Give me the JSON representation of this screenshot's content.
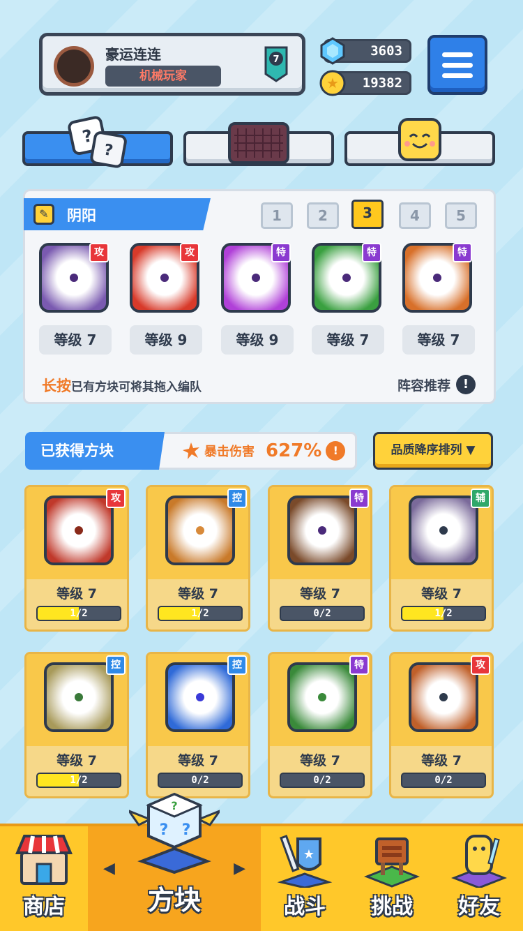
{
  "player": {
    "name": "豪运连连",
    "title": "机械玩家",
    "rank": "7"
  },
  "currency": {
    "gems": "3603",
    "coins": "19382"
  },
  "tabs": [
    {
      "name": "dice",
      "active": true
    },
    {
      "name": "board",
      "active": false
    },
    {
      "name": "emote",
      "active": false
    }
  ],
  "deck": {
    "name": "阴阳",
    "pages": [
      "1",
      "2",
      "3",
      "4",
      "5"
    ],
    "active_page": "3",
    "slots": [
      {
        "tag": "攻",
        "tag_type": "atk",
        "level": "等级 7",
        "color": "#7a5ab0"
      },
      {
        "tag": "攻",
        "tag_type": "atk",
        "level": "等级 9",
        "color": "#d83a2a"
      },
      {
        "tag": "特",
        "tag_type": "spc",
        "level": "等级 9",
        "color": "#b040d8"
      },
      {
        "tag": "特",
        "tag_type": "spc",
        "level": "等级 7",
        "color": "#3aa040"
      },
      {
        "tag": "特",
        "tag_type": "spc",
        "level": "等级 7",
        "color": "#d8702a"
      }
    ],
    "hint_highlight": "长按",
    "hint_text": "已有方块可将其拖入编队",
    "recommend": "阵容推荐"
  },
  "obtained": {
    "label": "已获得方块",
    "crit_label": "暴击伤害",
    "crit_value": "627%",
    "sort_label": "品质降序排列 ▼"
  },
  "blocks": [
    {
      "tag": "攻",
      "tag_type": "atk",
      "level": "等级 7",
      "progress": "1/2",
      "fill": 0.5,
      "color": "#c0392b",
      "core": "#8a2a1a"
    },
    {
      "tag": "控",
      "tag_type": "ctl",
      "level": "等级 7",
      "progress": "1/2",
      "fill": 0.5,
      "color": "#c97a2a",
      "core": "#d88a3a"
    },
    {
      "tag": "特",
      "tag_type": "spc",
      "level": "等级 7",
      "progress": "0/2",
      "fill": 0,
      "color": "#7a4a2a",
      "core": "#4a2a7a"
    },
    {
      "tag": "辅",
      "tag_type": "sup",
      "level": "等级 7",
      "progress": "1/2",
      "fill": 0.5,
      "color": "#7a6a9a",
      "core": "#2e3a4c"
    },
    {
      "tag": "控",
      "tag_type": "ctl",
      "level": "等级 7",
      "progress": "1/2",
      "fill": 0.5,
      "color": "#a89a5a",
      "core": "#3a7a3a"
    },
    {
      "tag": "控",
      "tag_type": "ctl",
      "level": "等级 7",
      "progress": "0/2",
      "fill": 0,
      "color": "#2f6ad8",
      "core": "#3a3ad8"
    },
    {
      "tag": "特",
      "tag_type": "spc",
      "level": "等级 7",
      "progress": "0/2",
      "fill": 0,
      "color": "#3a8a3a",
      "core": "#3a8a3a"
    },
    {
      "tag": "攻",
      "tag_type": "atk",
      "level": "等级 7",
      "progress": "0/2",
      "fill": 0,
      "color": "#c0602a",
      "core": "#2e3a4c"
    }
  ],
  "nav": [
    {
      "label": "商店",
      "icon": "shop-icon",
      "active": false
    },
    {
      "label": "方块",
      "icon": "block-icon",
      "active": true
    },
    {
      "label": "战斗",
      "icon": "battle-icon",
      "active": false
    },
    {
      "label": "挑战",
      "icon": "challenge-icon",
      "active": false
    },
    {
      "label": "好友",
      "icon": "friends-icon",
      "active": false
    }
  ]
}
